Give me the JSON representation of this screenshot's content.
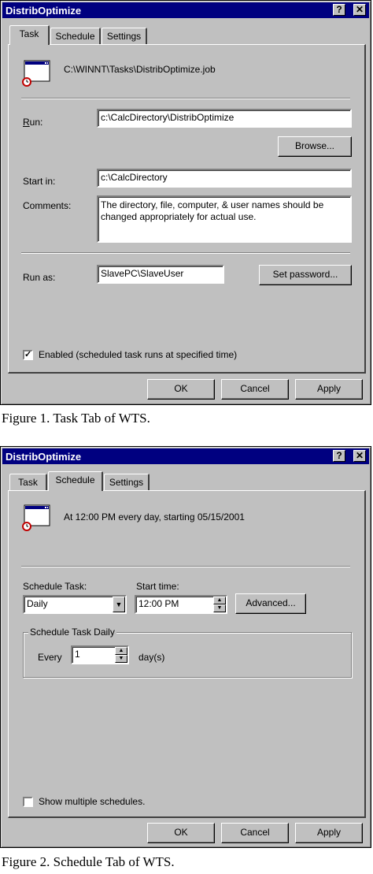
{
  "window1": {
    "title": "DistribOptimize",
    "help_button": "?",
    "close_button": "✕",
    "tabs": [
      {
        "label": "Task",
        "active": true
      },
      {
        "label": "Schedule",
        "active": false
      },
      {
        "label": "Settings",
        "active": false
      }
    ],
    "job_path": "C:\\WINNT\\Tasks\\DistribOptimize.job",
    "run_label": "Run:",
    "run_value": "c:\\CalcDirectory\\DistribOptimize",
    "browse_label": "Browse...",
    "start_in_label": "Start in:",
    "start_in_value": "c:\\CalcDirectory",
    "comments_label": "Comments:",
    "comments_value": "The directory, file, computer, & user names should be changed appropriately for actual use.",
    "run_as_label": "Run as:",
    "run_as_value": "SlavePC\\SlaveUser",
    "set_password_label": "Set password...",
    "enabled_checked": true,
    "enabled_label": "Enabled (scheduled task runs at specified time)",
    "ok_label": "OK",
    "cancel_label": "Cancel",
    "apply_label": "Apply"
  },
  "caption1": "Figure 1.  Task Tab of WTS.",
  "window2": {
    "title": "DistribOptimize",
    "help_button": "?",
    "close_button": "✕",
    "tabs": [
      {
        "label": "Task",
        "active": false
      },
      {
        "label": "Schedule",
        "active": true
      },
      {
        "label": "Settings",
        "active": false
      }
    ],
    "schedule_summary": "At 12:00 PM every day, starting 05/15/2001",
    "schedule_task_label": "Schedule Task:",
    "schedule_task_value": "Daily",
    "start_time_label": "Start time:",
    "start_time_value": "12:00 PM",
    "advanced_label": "Advanced...",
    "group_label": "Schedule Task Daily",
    "every_label": "Every",
    "every_value": "1",
    "days_label": "day(s)",
    "show_multiple_checked": false,
    "show_multiple_label": "Show multiple schedules.",
    "ok_label": "OK",
    "cancel_label": "Cancel",
    "apply_label": "Apply"
  },
  "caption2": "Figure 2.  Schedule Tab of WTS."
}
